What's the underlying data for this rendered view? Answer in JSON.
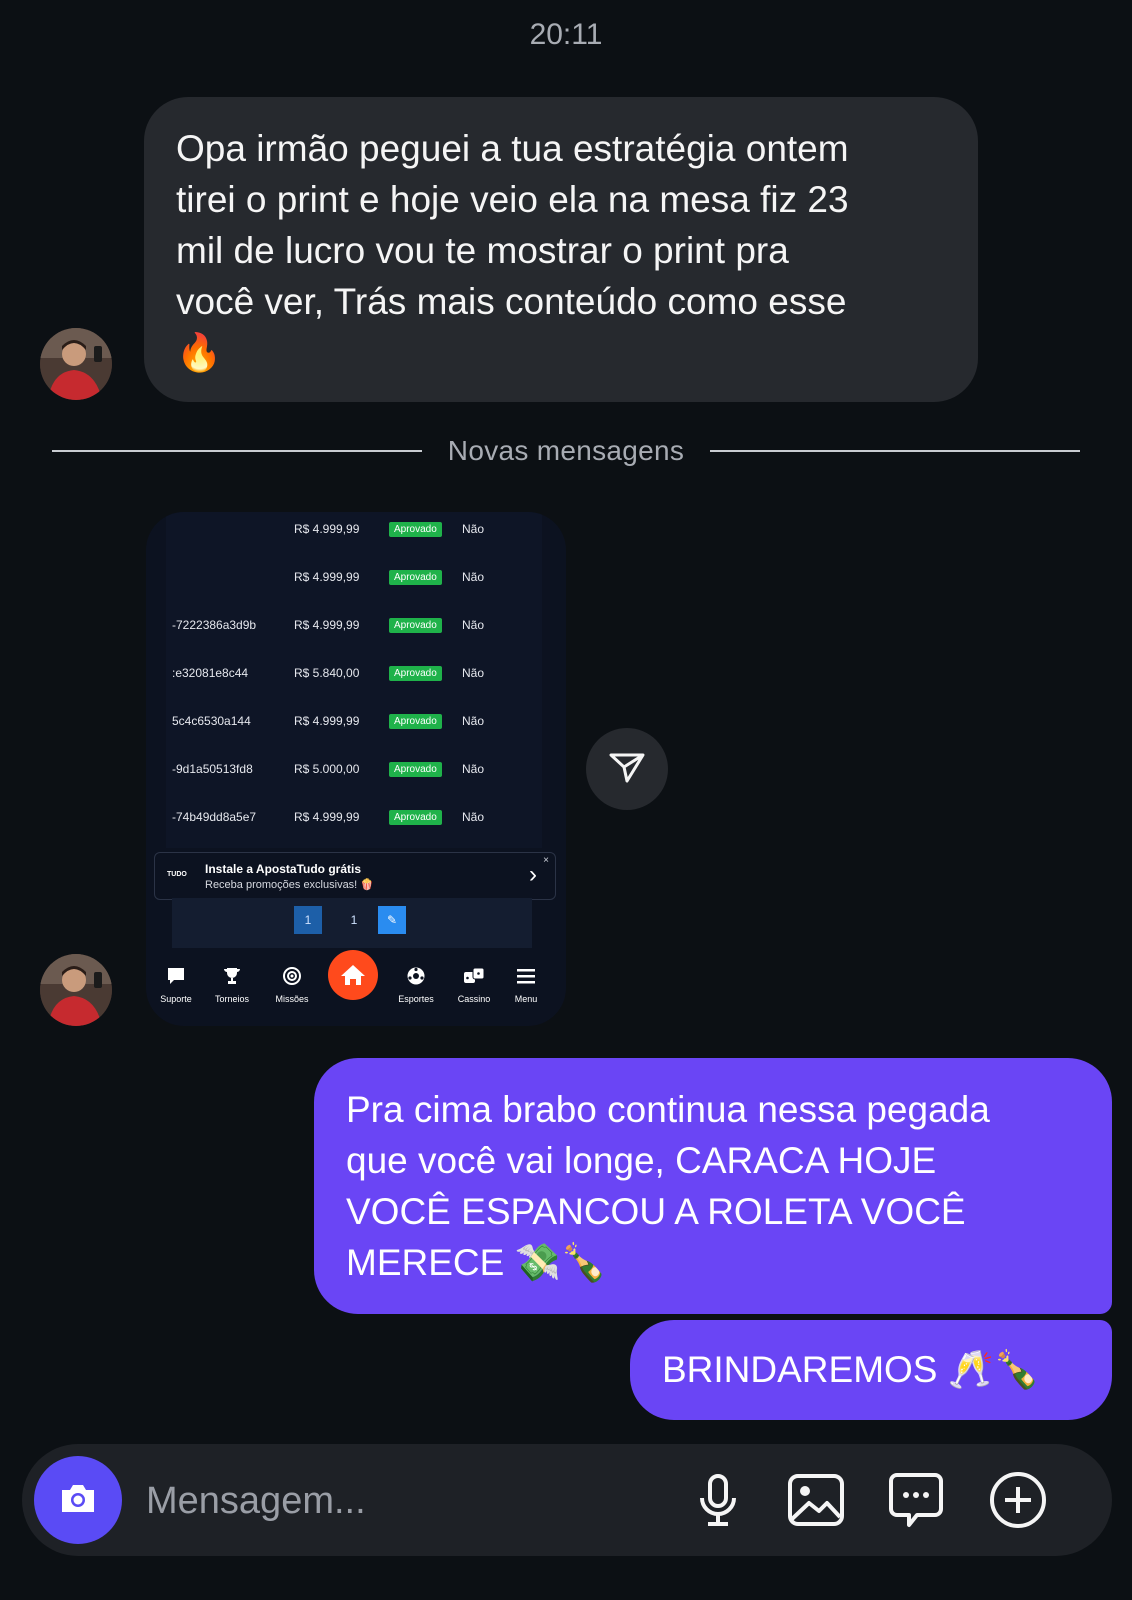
{
  "thread": {
    "timestamp": "20:11",
    "incoming_message": {
      "lines": [
        "Opa irmão peguei a tua estratégia ontem",
        "tirei o print e hoje veio ela na mesa fiz 23",
        "mil de lucro vou te mostrar o print pra",
        "você ver, Trás mais conteúdo como esse"
      ],
      "emoji": "🔥"
    },
    "new_messages_label": "Novas mensagens",
    "screenshot": {
      "rows": [
        {
          "id": "",
          "amount": "R$ 4.999,99",
          "status": "Aprovado",
          "flag": "Não"
        },
        {
          "id": "",
          "amount": "R$ 4.999,99",
          "status": "Aprovado",
          "flag": "Não"
        },
        {
          "id": "-7222386a3d9b",
          "amount": "R$ 4.999,99",
          "status": "Aprovado",
          "flag": "Não"
        },
        {
          "id": ":e32081e8c44",
          "amount": "R$ 5.840,00",
          "status": "Aprovado",
          "flag": "Não"
        },
        {
          "id": "5c4c6530a144",
          "amount": "R$ 4.999,99",
          "status": "Aprovado",
          "flag": "Não"
        },
        {
          "id": "-9d1a50513fd8",
          "amount": "R$ 5.000,00",
          "status": "Aprovado",
          "flag": "Não"
        },
        {
          "id": "-74b49dd8a5e7",
          "amount": "R$ 4.999,99",
          "status": "Aprovado",
          "flag": "Não"
        }
      ],
      "banner": {
        "logo": "TUDO",
        "title": "Instale a ApostaTudo grátis",
        "subtitle": "Receba promoções exclusivas! 🍿",
        "close": "×",
        "chevron": "›"
      },
      "pager": [
        "1",
        "1"
      ],
      "nav": [
        "Suporte",
        "Torneios",
        "Missões",
        "Esportes",
        "Cassino",
        "Menu"
      ]
    },
    "outgoing_1": {
      "lines": [
        "Pra cima brabo continua nessa pegada",
        "que você vai longe, CARACA HOJE",
        "VOCÊ ESPANCOU A ROLETA VOCÊ",
        "MERECE"
      ],
      "emoji": "💸🍾"
    },
    "outgoing_2": {
      "text": "BRINDAREMOS",
      "emoji": "🥂🍾"
    }
  },
  "composer": {
    "placeholder": "Mensagem..."
  },
  "colors": {
    "background": "#0c1014",
    "incoming_bubble": "#26292e",
    "outgoing_bubble": "#6a45f5",
    "camera_button": "#5a4bf5",
    "approved_badge": "#1fb24a",
    "home_button": "#ff4a1c"
  },
  "icons": [
    "camera-icon",
    "microphone-icon",
    "image-icon",
    "sticker-icon",
    "plus-circle-icon",
    "send-icon"
  ]
}
